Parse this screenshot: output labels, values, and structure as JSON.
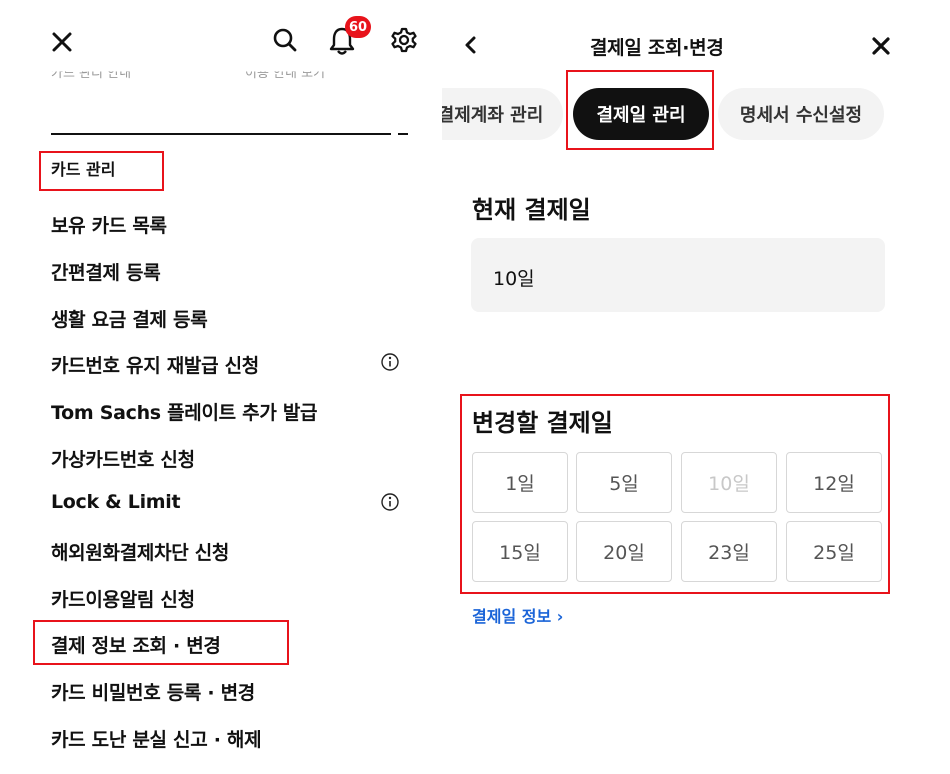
{
  "left_panel": {
    "notification_count": "60",
    "faded_text_1": "카드 관리 안내",
    "faded_text_2": "이용 안내 보기",
    "section_title": "카드 관리",
    "menu": [
      {
        "label": "보유 카드 목록",
        "info": false
      },
      {
        "label": "간편결제 등록",
        "info": false
      },
      {
        "label": "생활 요금 결제 등록",
        "info": false
      },
      {
        "label": "카드번호 유지 재발급 신청",
        "info": true
      },
      {
        "label": "Tom Sachs 플레이트 추가 발급",
        "info": false
      },
      {
        "label": "가상카드번호 신청",
        "info": false
      },
      {
        "label": "Lock & Limit",
        "info": true
      },
      {
        "label": "해외원화결제차단 신청",
        "info": false
      },
      {
        "label": "카드이용알림 신청",
        "info": false
      },
      {
        "label": "결제 정보 조회 · 변경",
        "info": false
      },
      {
        "label": "카드 비밀번호 등록 · 변경",
        "info": false
      },
      {
        "label": "카드 도난 분실 신고 · 해제",
        "info": false
      }
    ]
  },
  "right_panel": {
    "header_title": "결제일 조회·변경",
    "tabs": [
      {
        "label": "결제계좌 관리",
        "active": false
      },
      {
        "label": "결제일 관리",
        "active": true
      },
      {
        "label": "명세서 수신설정",
        "active": false
      }
    ],
    "current_label": "현재 결제일",
    "current_value": "10일",
    "change_label": "변경할 결제일",
    "days": [
      {
        "label": "1일",
        "disabled": false
      },
      {
        "label": "5일",
        "disabled": false
      },
      {
        "label": "10일",
        "disabled": true
      },
      {
        "label": "12일",
        "disabled": false
      },
      {
        "label": "15일",
        "disabled": false
      },
      {
        "label": "20일",
        "disabled": false
      },
      {
        "label": "23일",
        "disabled": false
      },
      {
        "label": "25일",
        "disabled": false
      }
    ],
    "info_link": "결제일 정보 ›",
    "link_color": "#1a64d8"
  },
  "colors": {
    "highlight": "#e8131b",
    "badge": "#e8131b"
  }
}
